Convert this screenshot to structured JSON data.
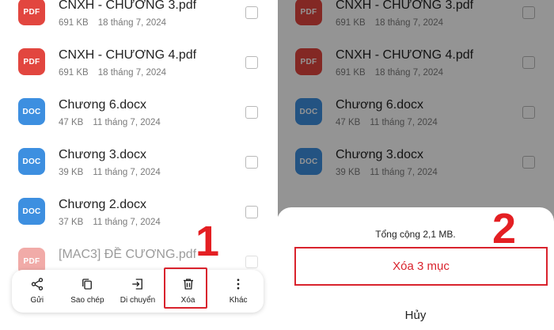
{
  "left_files": [
    {
      "type": "PDF",
      "name": "CNXH - CHƯƠNG 3.pdf",
      "size": "691 KB",
      "date": "18 tháng 7, 2024"
    },
    {
      "type": "PDF",
      "name": "CNXH - CHƯƠNG 4.pdf",
      "size": "691 KB",
      "date": "18 tháng 7, 2024"
    },
    {
      "type": "DOC",
      "name": "Chương 6.docx",
      "size": "47 KB",
      "date": "11 tháng 7, 2024"
    },
    {
      "type": "DOC",
      "name": "Chương 3.docx",
      "size": "39 KB",
      "date": "11 tháng 7, 2024"
    },
    {
      "type": "DOC",
      "name": "Chương 2.docx",
      "size": "37 KB",
      "date": "11 tháng 7, 2024"
    },
    {
      "type": "PDF",
      "name": "[MAC3] ĐỀ CƯƠNG.pdf",
      "size": "",
      "date": ""
    }
  ],
  "right_files": [
    {
      "type": "PDF",
      "name": "CNXH - CHƯƠNG 3.pdf",
      "size": "691 KB",
      "date": "18 tháng 7, 2024"
    },
    {
      "type": "PDF",
      "name": "CNXH - CHƯƠNG 4.pdf",
      "size": "691 KB",
      "date": "18 tháng 7, 2024"
    },
    {
      "type": "DOC",
      "name": "Chương 6.docx",
      "size": "47 KB",
      "date": "11 tháng 7, 2024"
    },
    {
      "type": "DOC",
      "name": "Chương 3.docx",
      "size": "39 KB",
      "date": "11 tháng 7, 2024"
    }
  ],
  "toolbar": {
    "send": "Gửi",
    "copy": "Sao chép",
    "move": "Di chuyển",
    "delete": "Xóa",
    "more": "Khác"
  },
  "steps": {
    "one": "1",
    "two": "2"
  },
  "sheet": {
    "total": "Tổng cộng 2,1 MB.",
    "delete_label": "Xóa 3 mục",
    "cancel_label": "Hủy"
  },
  "colors": {
    "pdf": "#e2463f",
    "doc": "#3d8fe0",
    "accent": "#d9232d"
  }
}
